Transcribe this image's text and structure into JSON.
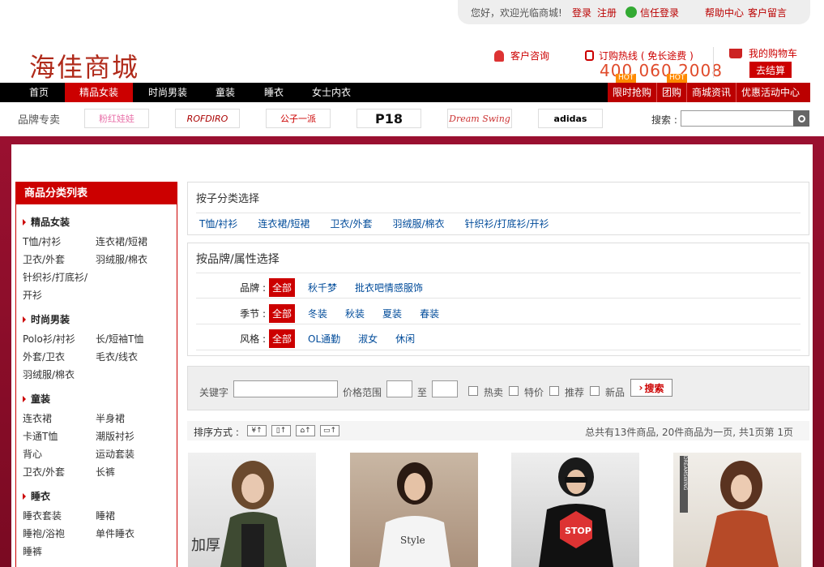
{
  "topbar": {
    "welcome": "您好，欢迎光临商城!",
    "login": "登录",
    "register": "注册",
    "trust_login": "信任登录",
    "help": "帮助中心",
    "message": "客户留言"
  },
  "header": {
    "logo": "海佳商城",
    "consult": "客户咨询",
    "hotline_label": "订购热线 ( 免长途费 )",
    "phone": "400 060 2008",
    "hot": "HOT",
    "cart": "我的购物车",
    "checkout": "去结算"
  },
  "nav": {
    "items": [
      "首页",
      "精品女装",
      "时尚男装",
      "童装",
      "睡衣",
      "女士内衣"
    ],
    "right_items": [
      "限时抢购",
      "团购",
      "商城资讯",
      "优惠活动中心"
    ]
  },
  "brands": {
    "title": "品牌专卖",
    "items": [
      "粉红娃娃",
      "ROFDIRO",
      "公子一派",
      "P18",
      "Dream Swing",
      "adidas"
    ],
    "search_label": "搜索 :"
  },
  "sidebar": {
    "title": "商品分类列表",
    "categories": [
      {
        "name": "精品女装",
        "items": [
          "T恤/衬衫",
          "连衣裙/短裙",
          "卫衣/外套",
          "羽绒服/棉衣",
          "针织衫/打底衫/",
          "",
          "开衫",
          ""
        ]
      },
      {
        "name": "时尚男装",
        "items": [
          "Polo衫/衬衫",
          "长/短袖T恤",
          "外套/卫衣",
          "毛衣/线衣",
          "羽绒服/棉衣",
          ""
        ]
      },
      {
        "name": "童装",
        "items": [
          "连衣裙",
          "半身裙",
          "卡通T恤",
          "潮版衬衫",
          "背心",
          "运动套装",
          "卫衣/外套",
          "长裤"
        ]
      },
      {
        "name": "睡衣",
        "items": [
          "睡衣套装",
          "睡裙",
          "睡袍/浴袍",
          "单件睡衣",
          "睡裤",
          ""
        ]
      }
    ]
  },
  "subcat": {
    "title": "按子分类选择",
    "links": [
      "T恤/衬衫",
      "连衣裙/短裙",
      "卫衣/外套",
      "羽绒服/棉衣",
      "针织衫/打底衫/开衫"
    ]
  },
  "attrs": {
    "title": "按品牌/属性选择",
    "all": "全部",
    "rows": [
      {
        "label": "品牌 :",
        "options": [
          "秋千梦",
          "批衣吧情感服饰"
        ]
      },
      {
        "label": "季节 :",
        "options": [
          "冬装",
          "秋装",
          "夏装",
          "春装"
        ]
      },
      {
        "label": "风格 :",
        "options": [
          "OL通勤",
          "淑女",
          "休闲"
        ]
      }
    ]
  },
  "filter": {
    "keyword": "关键字",
    "price": "价格范围",
    "to": "至",
    "hot": "热卖",
    "special": "特价",
    "recommend": "推荐",
    "new": "新品",
    "search": "搜索"
  },
  "sort": {
    "label": "排序方式 :",
    "info": "总共有13件商品, 20件商品为一页, 共1页第  1页"
  },
  "products": {
    "p1_tag": "加厚",
    "p2_tag": "Style",
    "p3_tag": "STOP",
    "p4_tag": "DREAMSWING"
  }
}
